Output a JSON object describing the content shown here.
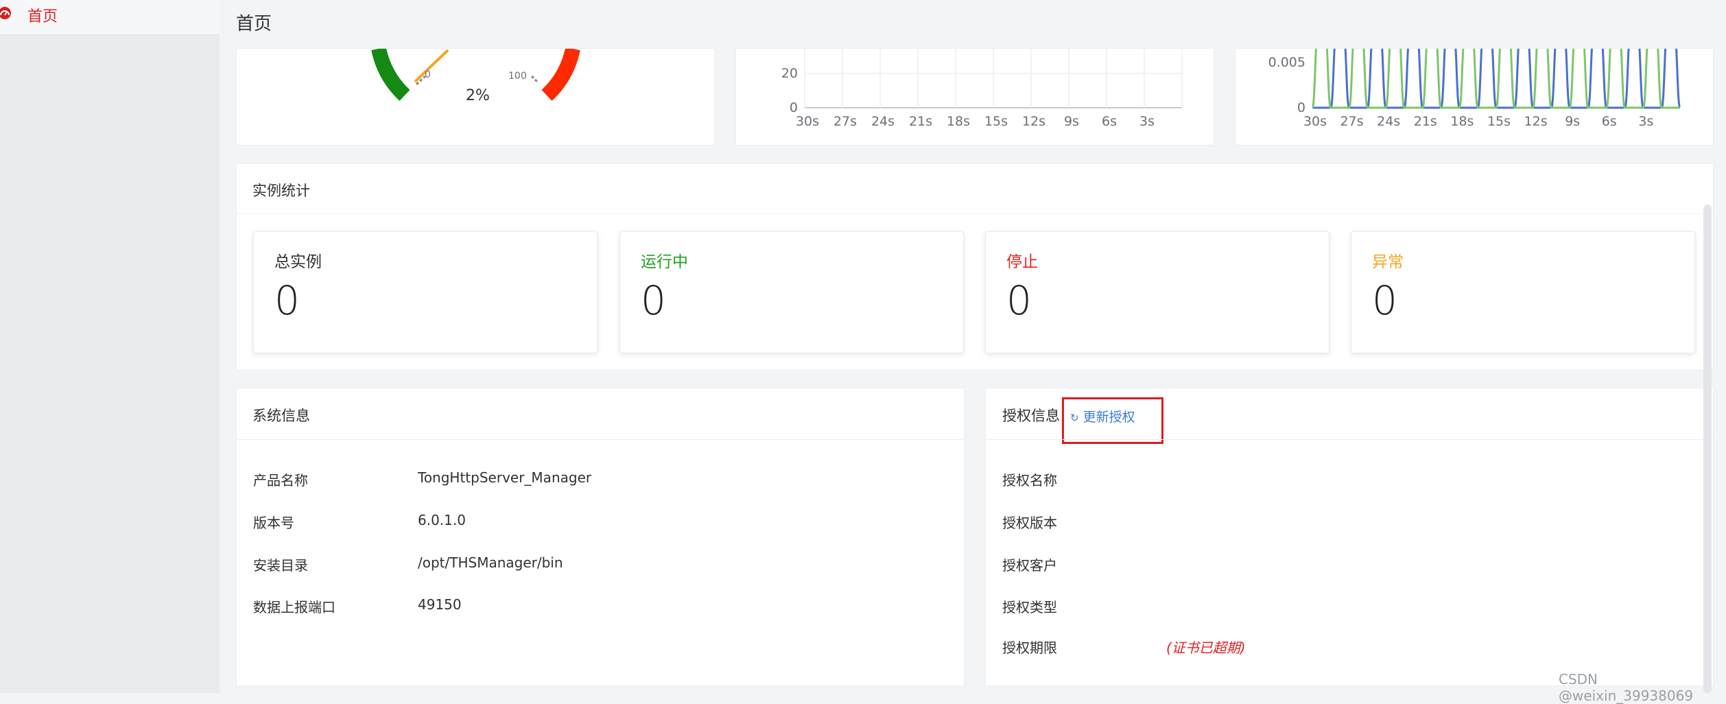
{
  "sidebar": {
    "items": [
      {
        "label": "首页",
        "icon": "dashboard-icon",
        "active": true
      }
    ]
  },
  "page": {
    "title": "首页"
  },
  "gauge": {
    "value_text": "2%",
    "min_label": "0",
    "max_label": "100",
    "colors": {
      "low": "#148a14",
      "high": "#ff2a00",
      "needle": "#f5a623"
    }
  },
  "chart_data": [
    {
      "type": "line",
      "x": [
        "30s",
        "27s",
        "24s",
        "21s",
        "18s",
        "15s",
        "12s",
        "9s",
        "6s",
        "3s"
      ],
      "ylabels": [
        "0",
        "20"
      ],
      "series": [],
      "grid": true
    },
    {
      "type": "line",
      "x": [
        "30s",
        "27s",
        "24s",
        "21s",
        "18s",
        "15s",
        "12s",
        "9s",
        "6s",
        "3s"
      ],
      "ylabels": [
        "0",
        "0.005"
      ],
      "series": [
        {
          "color": "#4a6fcf",
          "values": [
            0,
            1,
            0,
            1,
            0,
            1,
            0,
            1,
            0,
            1,
            0,
            1,
            0,
            1,
            0,
            1,
            0,
            1,
            0,
            1
          ]
        },
        {
          "color": "#7cc66a",
          "values": [
            1,
            0,
            1,
            0,
            1,
            0,
            1,
            0,
            1,
            0,
            1,
            0,
            1,
            0,
            1,
            0,
            1,
            0,
            1,
            0
          ]
        }
      ],
      "grid": false
    }
  ],
  "instance_stats": {
    "title": "实例统计",
    "cards": [
      {
        "label": "总实例",
        "value": "0",
        "color": "#303133"
      },
      {
        "label": "运行中",
        "value": "0",
        "color": "#1fa31f"
      },
      {
        "label": "停止",
        "value": "0",
        "color": "#e8231a"
      },
      {
        "label": "异常",
        "value": "0",
        "color": "#f5a623"
      }
    ]
  },
  "system_info": {
    "title": "系统信息",
    "rows": [
      {
        "label": "产品名称",
        "value": "TongHttpServer_Manager"
      },
      {
        "label": "版本号",
        "value": "6.0.1.0"
      },
      {
        "label": "安装目录",
        "value": "/opt/THSManager/bin"
      },
      {
        "label": "数据上报端口",
        "value": "49150"
      }
    ]
  },
  "license_info": {
    "title": "授权信息",
    "refresh_label": "更新授权",
    "rows": [
      {
        "label": "授权名称",
        "value": ""
      },
      {
        "label": "授权版本",
        "value": ""
      },
      {
        "label": "授权客户",
        "value": ""
      },
      {
        "label": "授权类型",
        "value": ""
      },
      {
        "label": "授权期限",
        "value": "(证书已超期)"
      }
    ]
  },
  "watermark": "CSDN @weixin_39938069"
}
